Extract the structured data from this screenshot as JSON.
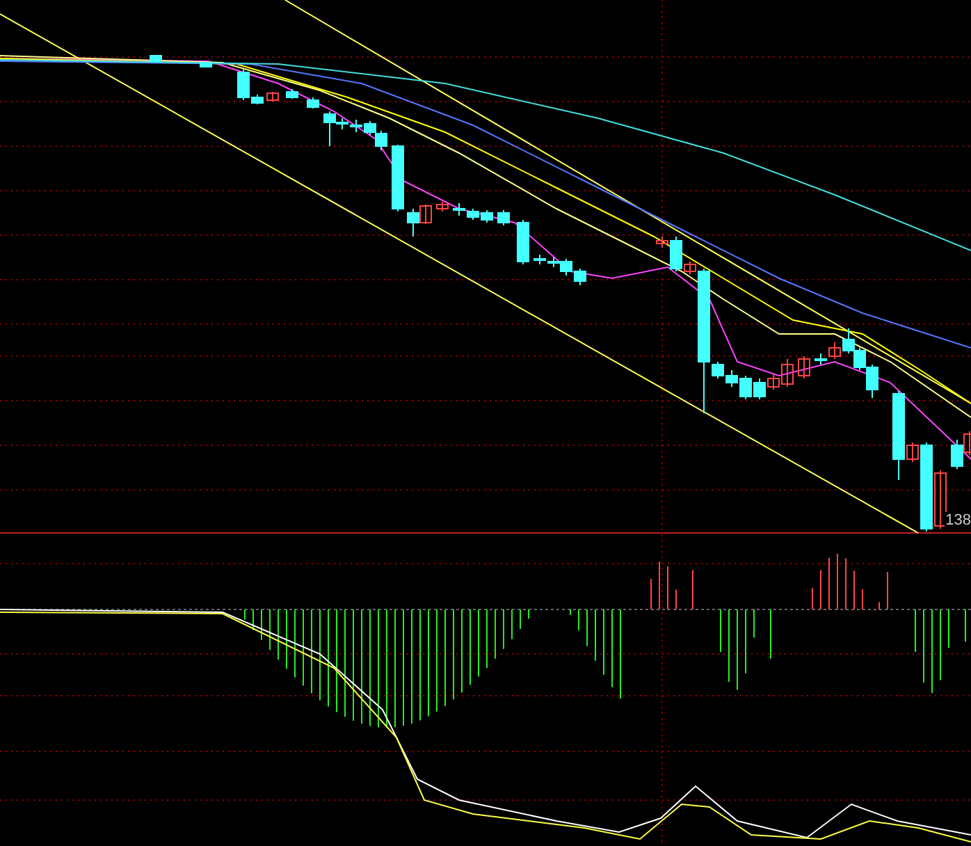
{
  "price_panel": {
    "low_label": "138"
  }
}
